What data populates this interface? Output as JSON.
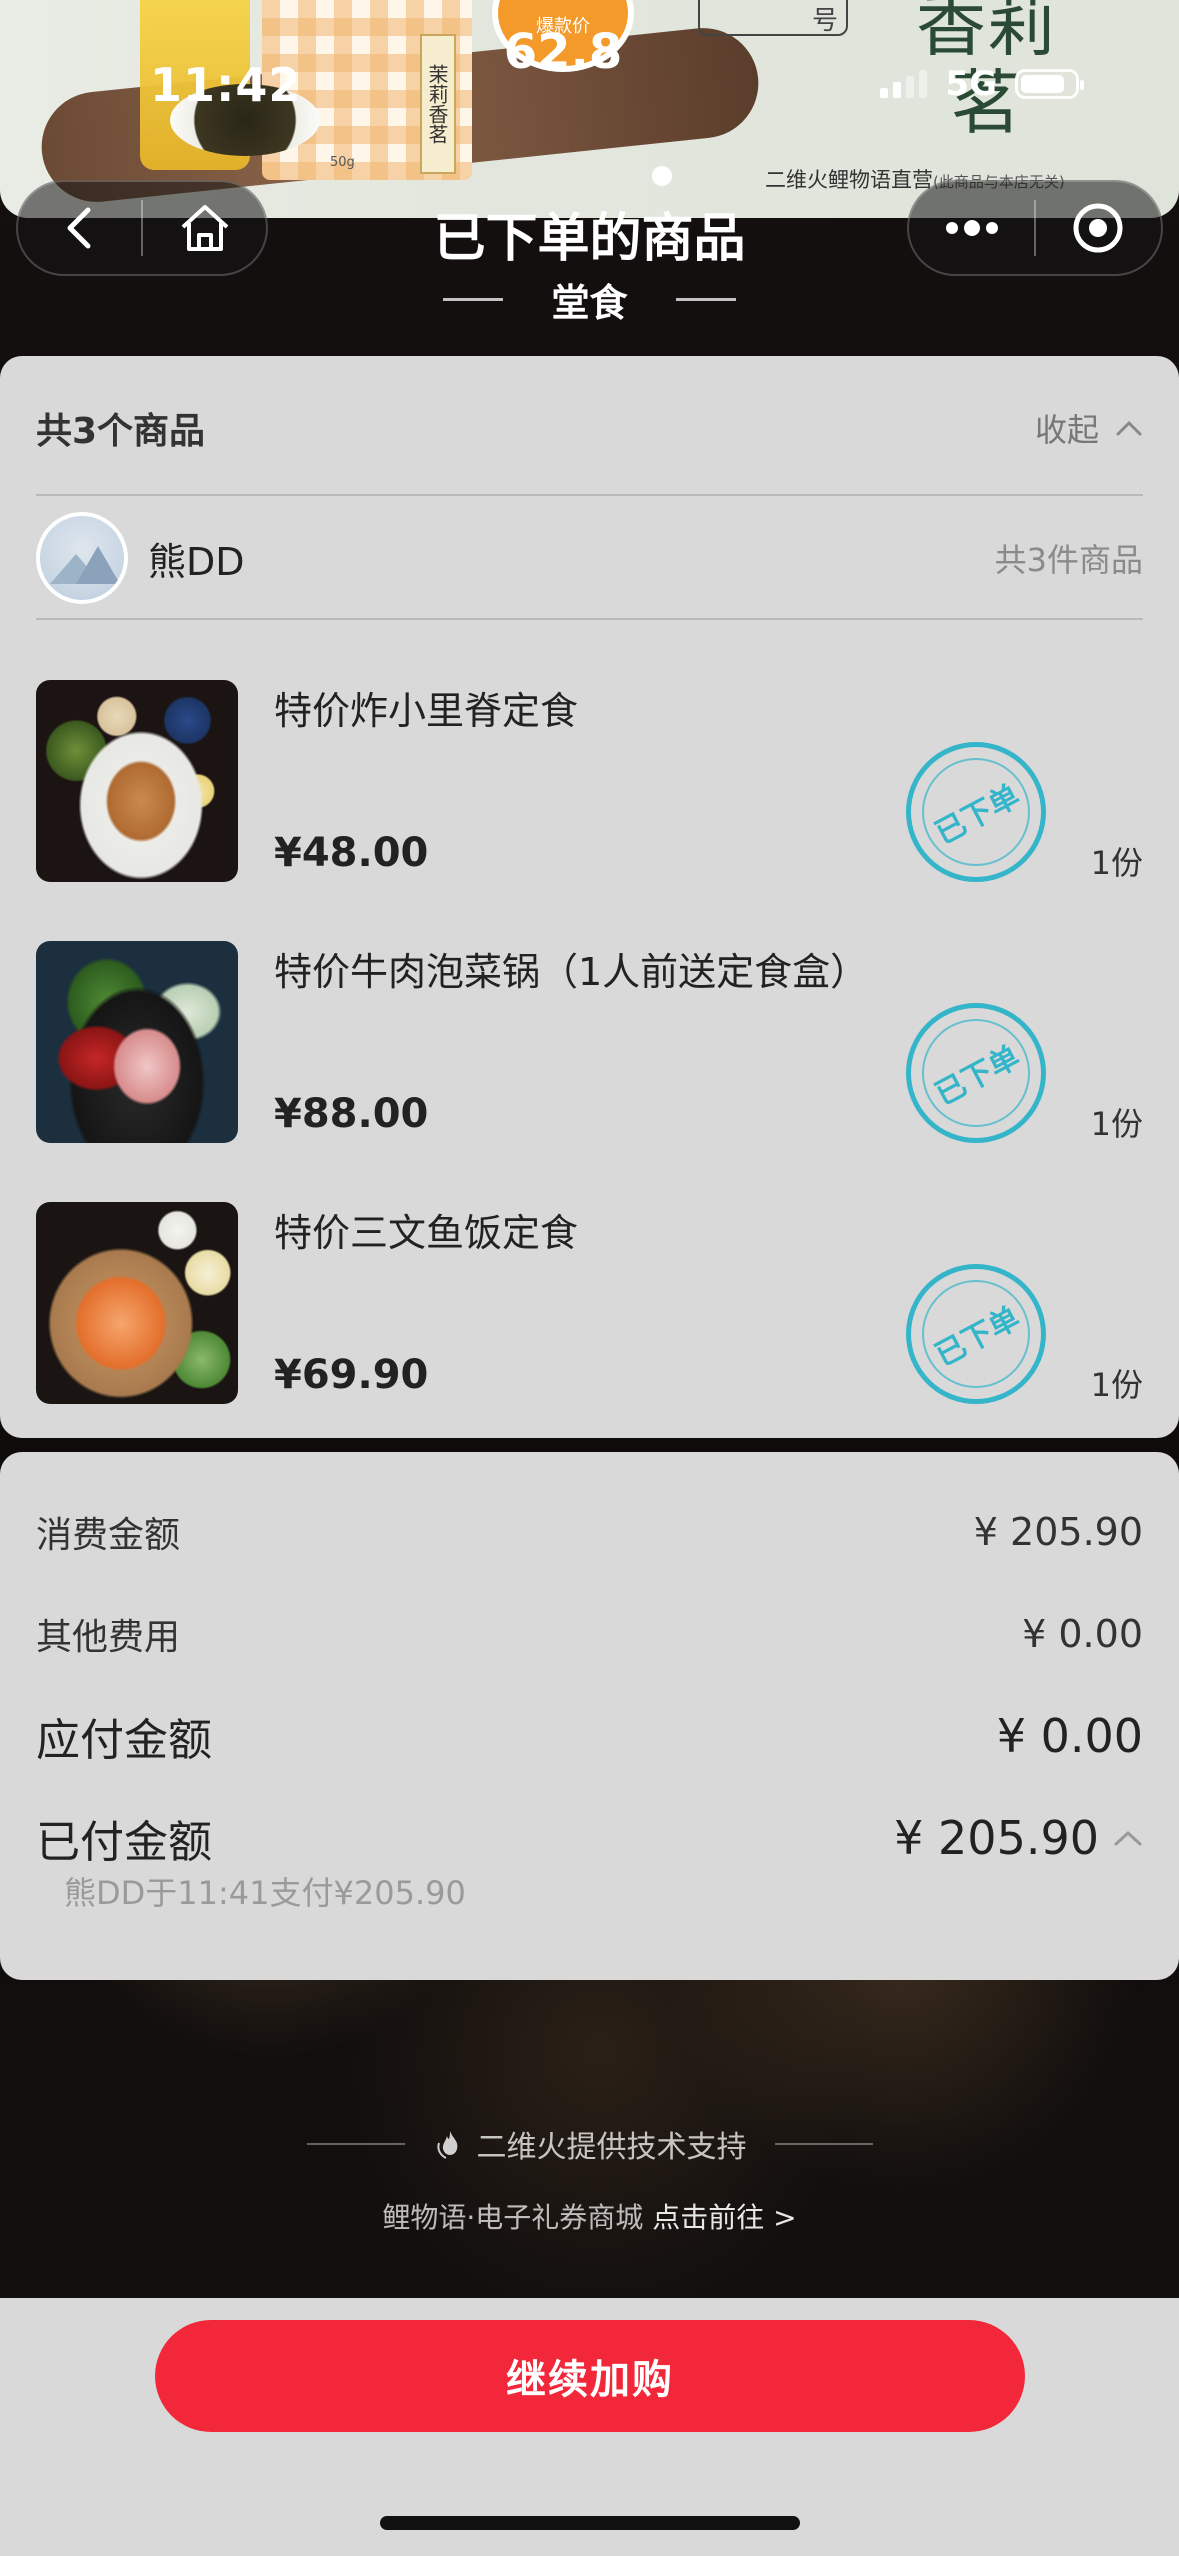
{
  "status_bar": {
    "time": "11:42",
    "network": "5G"
  },
  "banner": {
    "price_label": "爆款价",
    "price": "62.8",
    "package_label": "茉莉香茗",
    "package_weight": "50g",
    "stamp_text": "号",
    "title_text": "香莉茗",
    "sponsor": "二维火鲤物语直营",
    "sponsor_note": "(此商品与本店无关)"
  },
  "header": {
    "title": "已下单的商品",
    "subtitle": "堂食"
  },
  "nav": {
    "back_icon": "chevron-left-icon",
    "home_icon": "home-icon",
    "more_icon": "more-dots-icon",
    "target_icon": "target-icon"
  },
  "items_card": {
    "count_label": "共3个商品",
    "collapse_label": "收起",
    "customer": {
      "name": "熊DD",
      "total_count": "共3件商品"
    },
    "items": [
      {
        "title": "特价炸小里脊定食",
        "price": "¥48.00",
        "qty": "1份",
        "stamp": "已下单"
      },
      {
        "title": "特价牛肉泡菜锅（1人前送定食盒）",
        "price": "¥88.00",
        "qty": "1份",
        "stamp": "已下单"
      },
      {
        "title": "特价三文鱼饭定食",
        "price": "¥69.90",
        "qty": "1份",
        "stamp": "已下单"
      }
    ]
  },
  "summary": {
    "consumption": {
      "label": "消费金额",
      "value": "¥ 205.90"
    },
    "other_fee": {
      "label": "其他费用",
      "value": "¥ 0.00"
    },
    "payable": {
      "label": "应付金额",
      "value": "¥ 0.00"
    },
    "paid": {
      "label": "已付金额",
      "value": "¥ 205.90"
    },
    "paid_note": "熊DD于11:41支付¥205.90"
  },
  "footer": {
    "support": "二维火提供技术支持",
    "mall": "鲤物语·电子礼券商城",
    "mall_link": "点击前往 >"
  },
  "cta": {
    "label": "继续加购"
  }
}
